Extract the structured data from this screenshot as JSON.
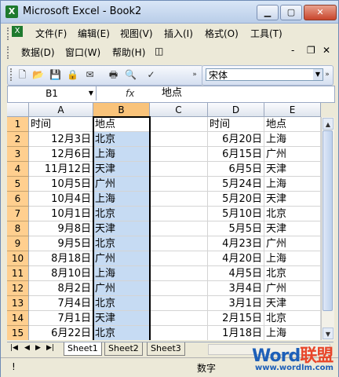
{
  "window": {
    "title": "Microsoft Excel - Book2",
    "app_icon": "excel-icon"
  },
  "menu": {
    "row1": [
      "文件(F)",
      "编辑(E)",
      "视图(V)",
      "插入(I)",
      "格式(O)",
      "工具(T)"
    ],
    "row2": [
      "数据(D)",
      "窗口(W)",
      "帮助(H)"
    ]
  },
  "font_box": {
    "value": "宋体"
  },
  "formula_bar": {
    "name_box": "B1",
    "fx": "fx",
    "value": "地点"
  },
  "columns": [
    "A",
    "B",
    "C",
    "D",
    "E"
  ],
  "rows": [
    {
      "n": "1",
      "a": "时间",
      "b": "地点",
      "d": "时间",
      "e": "地点"
    },
    {
      "n": "2",
      "a": "12月3日",
      "b": "北京",
      "d": "6月20日",
      "e": "上海"
    },
    {
      "n": "3",
      "a": "12月6日",
      "b": "上海",
      "d": "6月15日",
      "e": "广州"
    },
    {
      "n": "4",
      "a": "11月12日",
      "b": "天津",
      "d": "6月5日",
      "e": "天津"
    },
    {
      "n": "5",
      "a": "10月5日",
      "b": "广州",
      "d": "5月24日",
      "e": "上海"
    },
    {
      "n": "6",
      "a": "10月4日",
      "b": "上海",
      "d": "5月20日",
      "e": "天津"
    },
    {
      "n": "7",
      "a": "10月1日",
      "b": "北京",
      "d": "5月10日",
      "e": "北京"
    },
    {
      "n": "8",
      "a": "9月8日",
      "b": "天津",
      "d": "5月5日",
      "e": "天津"
    },
    {
      "n": "9",
      "a": "9月5日",
      "b": "北京",
      "d": "4月23日",
      "e": "广州"
    },
    {
      "n": "10",
      "a": "8月18日",
      "b": "广州",
      "d": "4月20日",
      "e": "上海"
    },
    {
      "n": "11",
      "a": "8月10日",
      "b": "上海",
      "d": "4月5日",
      "e": "北京"
    },
    {
      "n": "12",
      "a": "8月2日",
      "b": "广州",
      "d": "3月4日",
      "e": "广州"
    },
    {
      "n": "13",
      "a": "7月4日",
      "b": "北京",
      "d": "3月1日",
      "e": "天津"
    },
    {
      "n": "14",
      "a": "7月1日",
      "b": "天津",
      "d": "2月15日",
      "e": "北京"
    },
    {
      "n": "15",
      "a": "6月22日",
      "b": "北京",
      "d": "1月18日",
      "e": "上海"
    }
  ],
  "sheets": [
    "Sheet1",
    "Sheet2",
    "Sheet3"
  ],
  "status": {
    "ready_icon": "!",
    "mode": "数字"
  },
  "watermark": {
    "logo_word": "Word",
    "logo_cn": "联盟",
    "url": "www.wordlm.com"
  },
  "colors": {
    "row_header": "#ffcf8f",
    "selection": "#c6dbf3",
    "title_gradient": "#b9cde8"
  }
}
